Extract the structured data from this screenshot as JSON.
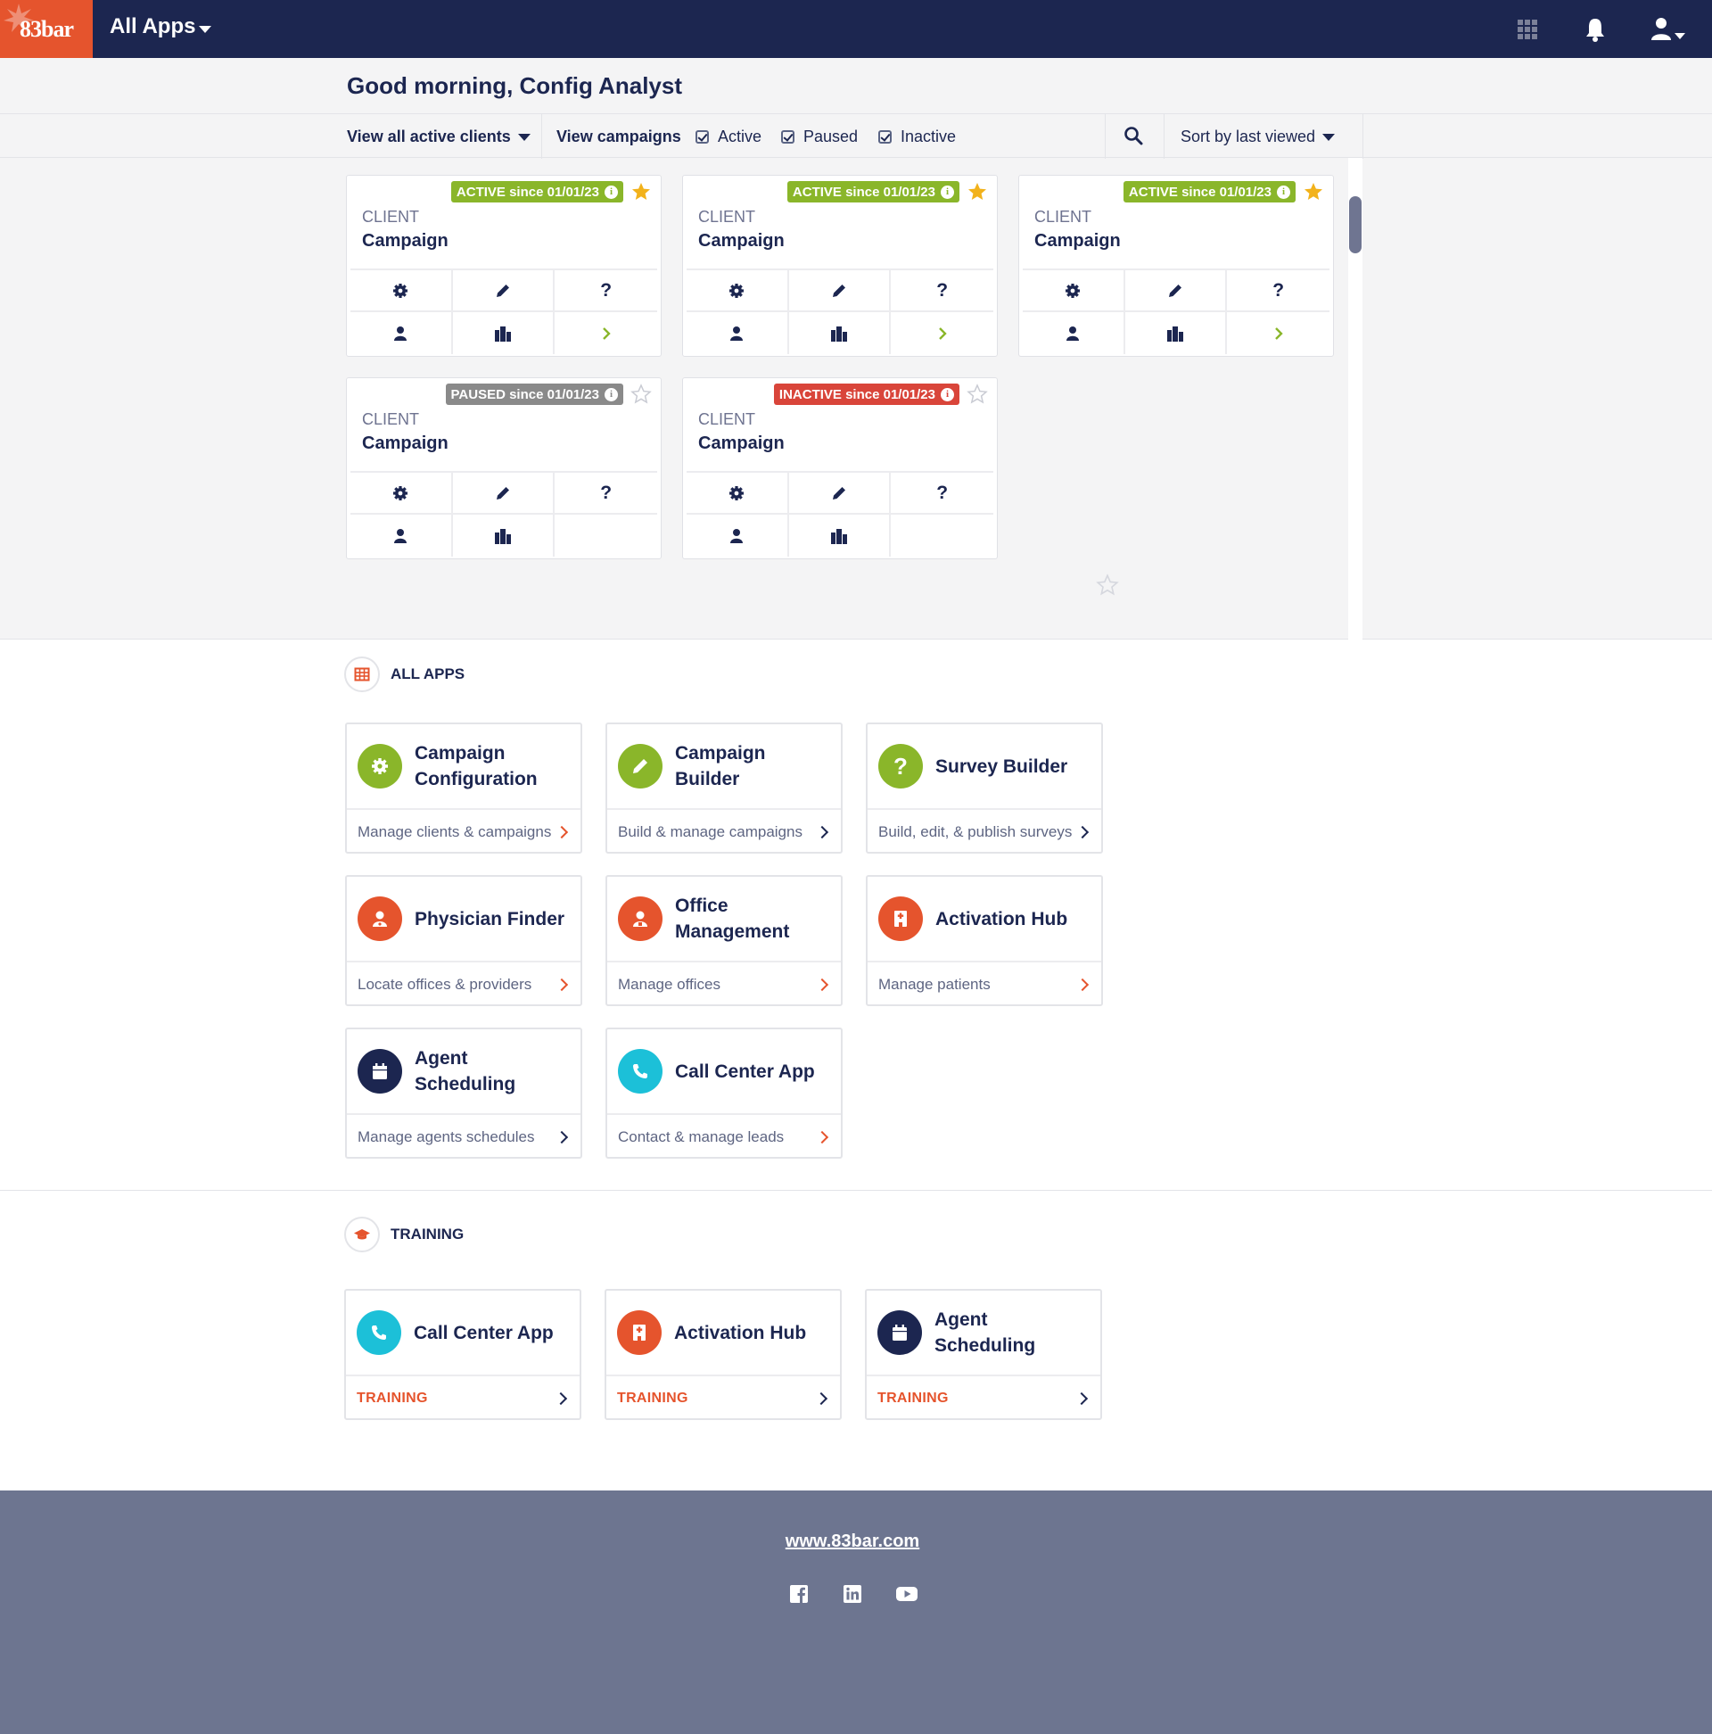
{
  "header": {
    "logo_text": "83bar",
    "title": "All Apps",
    "icons": [
      "grid-icon",
      "bell-icon",
      "user-icon"
    ]
  },
  "greeting": "Good morning, Config Analyst",
  "filters": {
    "clients_label": "View all active clients",
    "campaigns_label": "View campaigns",
    "active_label": "Active",
    "paused_label": "Paused",
    "inactive_label": "Inactive",
    "sort_label": "Sort by last viewed"
  },
  "colors": {
    "navy": "#1c2650",
    "orange": "#e5542d",
    "green": "#8ab62a",
    "grey": "#8a8a8a",
    "red": "#d9453a",
    "teal": "#1cc0d8",
    "star": "#f2b21b"
  },
  "campaign_cards": [
    {
      "status": "ACTIVE since 01/01/23",
      "client": "CLIENT",
      "campaign": "Campaign",
      "starred": true
    },
    {
      "status": "ACTIVE since 01/01/23",
      "client": "CLIENT",
      "campaign": "Campaign",
      "starred": true
    },
    {
      "status": "ACTIVE since 01/01/23",
      "client": "CLIENT",
      "campaign": "Campaign",
      "starred": true
    },
    {
      "status": "PAUSED since 01/01/23",
      "client": "CLIENT",
      "campaign": "Campaign",
      "starred": false
    },
    {
      "status": "INACTIVE since 01/01/23",
      "client": "CLIENT",
      "campaign": "Campaign",
      "starred": false
    }
  ],
  "all_apps": {
    "label": "ALL APPS",
    "apps": [
      {
        "title_line1": "Campaign",
        "title_line2": "Configuration",
        "desc": "Manage clients & campaigns",
        "icon": "gear-icon"
      },
      {
        "title_line1": "Campaign",
        "title_line2": "Builder",
        "desc": "Build & manage campaigns",
        "icon": "pencil-icon"
      },
      {
        "title_line1": "Survey Builder",
        "title_line2": "",
        "desc": "Build, edit, & publish surveys",
        "icon": "question-icon"
      },
      {
        "title_line1": "Physician Finder",
        "title_line2": "",
        "desc": "Locate offices & providers",
        "icon": "physician-icon"
      },
      {
        "title_line1": "Office",
        "title_line2": "Management",
        "desc": "Manage offices",
        "icon": "office-user-icon"
      },
      {
        "title_line1": "Activation Hub",
        "title_line2": "",
        "desc": "Manage patients",
        "icon": "hospital-icon"
      },
      {
        "title_line1": "Agent",
        "title_line2": "Scheduling",
        "desc": "Manage agents schedules",
        "icon": "calendar-icon"
      },
      {
        "title_line1": "Call Center App",
        "title_line2": "",
        "desc": "Contact & manage leads",
        "icon": "phone-icon"
      }
    ]
  },
  "training": {
    "label": "TRAINING",
    "items": [
      {
        "title_line1": "Call Center App",
        "title_line2": "",
        "action": "TRAINING",
        "icon": "phone-icon"
      },
      {
        "title_line1": "Activation Hub",
        "title_line2": "",
        "action": "TRAINING",
        "icon": "hospital-icon"
      },
      {
        "title_line1": "Agent",
        "title_line2": "Scheduling",
        "action": "TRAINING",
        "icon": "calendar-icon"
      }
    ]
  },
  "footer": {
    "link": "www.83bar.com",
    "social": [
      "facebook-icon",
      "linkedin-icon",
      "youtube-icon"
    ]
  }
}
